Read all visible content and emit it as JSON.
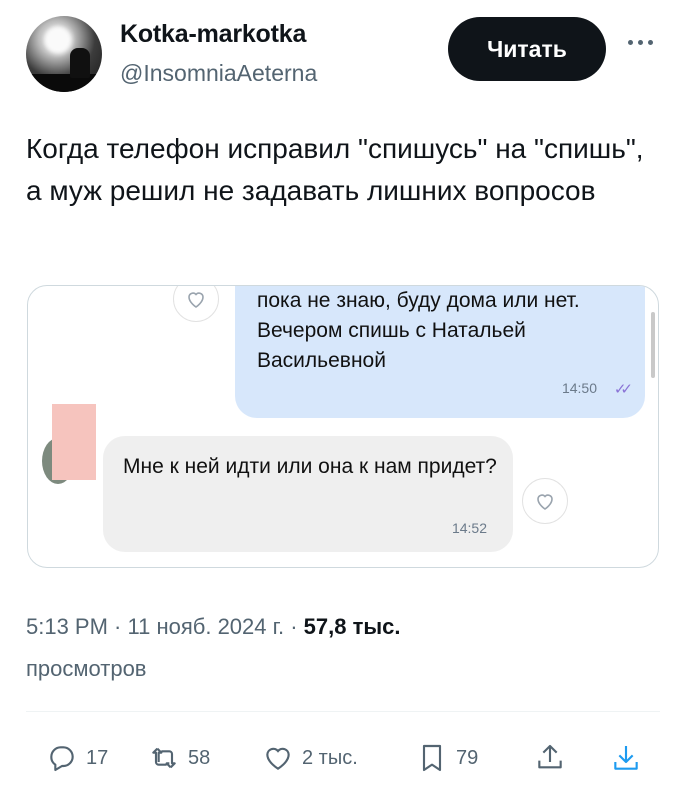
{
  "author": {
    "display_name": "Kotka-markotka",
    "handle": "@InsomniaAeterna",
    "avatar_icon": "avatar-photo"
  },
  "header": {
    "follow_label": "Читать",
    "more_icon": "more-horizontal-icon"
  },
  "tweet": {
    "text": "Когда телефон исправил \"спишусь\" на \"спишь\", а муж решил не задавать лишних вопросов"
  },
  "media": {
    "outgoing_message": {
      "text": "пока не знаю, буду дома или нет. Вечером спишь с Натальей Васильевной",
      "time": "14:50",
      "status": "✓✓"
    },
    "incoming_message": {
      "text": "Мне к ней идти или она к нам придет?",
      "time": "14:52"
    }
  },
  "meta": {
    "time": "5:13 PM",
    "separator": " · ",
    "date": "11 нояб. 2024 г.",
    "views_count": "57,8 тыс.",
    "views_label": "просмотров"
  },
  "actions": {
    "replies": "17",
    "reposts": "58",
    "likes": "2 тыс.",
    "bookmarks": "79"
  },
  "colors": {
    "text_primary": "#0f1419",
    "text_secondary": "#536471",
    "accent_link": "#1d9bf0",
    "outgoing_bubble": "#d7e7fb",
    "incoming_bubble": "#efefef"
  }
}
